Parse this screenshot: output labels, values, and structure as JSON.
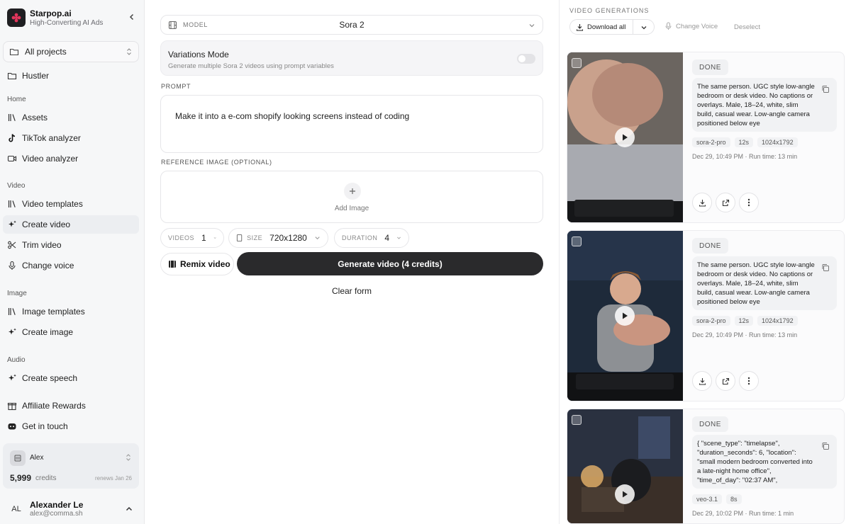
{
  "brand": {
    "name": "Starpop.ai",
    "tagline": "High-Converting AI Ads"
  },
  "projects": {
    "label": "All projects"
  },
  "sidebar": {
    "top_item": "Hustler",
    "sections": {
      "home": "Home",
      "video": "Video",
      "image": "Image",
      "audio": "Audio"
    },
    "items": {
      "assets": "Assets",
      "tiktok": "TikTok analyzer",
      "video_analyzer": "Video analyzer",
      "video_templates": "Video templates",
      "create_video": "Create video",
      "trim_video": "Trim video",
      "change_voice": "Change voice",
      "image_templates": "Image templates",
      "create_image": "Create image",
      "create_speech": "Create speech",
      "affiliate": "Affiliate Rewards",
      "get_in_touch": "Get in touch"
    }
  },
  "account": {
    "workspace": "Alex",
    "credits": "5,999",
    "credits_label": "credits",
    "renews": "renews Jan 26"
  },
  "user": {
    "initials": "AL",
    "name": "Alexander Le",
    "email": "alex@comma.sh"
  },
  "form": {
    "model_label": "MODEL",
    "model_value": "Sora 2",
    "variations_title": "Variations Mode",
    "variations_desc": "Generate multiple Sora 2 videos using prompt variables",
    "prompt_label": "PROMPT",
    "prompt_text": "Make it into a e-com shopify looking screens instead of coding",
    "reference_label": "REFERENCE IMAGE (OPTIONAL)",
    "add_image": "Add Image",
    "videos_label": "VIDEOS",
    "videos_value": "1",
    "size_label": "SIZE",
    "size_value": "720x1280",
    "duration_label": "DURATION",
    "duration_value": "4",
    "remix_label": "Remix video",
    "generate_label": "Generate video (4 credits)",
    "clear_label": "Clear form"
  },
  "generations": {
    "title": "VIDEO GENERATIONS",
    "download_all": "Download all",
    "change_voice": "Change Voice",
    "deselect": "Deselect",
    "items": [
      {
        "status": "DONE",
        "description": "The same person. UGC style low-angle bedroom or desk video. No captions or overlays. Male, 18–24, white, slim build, casual wear. Low-angle camera positioned below eye",
        "model": "sora-2-pro",
        "duration": "12s",
        "resolution": "1024x1792",
        "date": "Dec 29, 10:49 PM",
        "runtime": "Run time: 13 min"
      },
      {
        "status": "DONE",
        "description": "The same person. UGC style low-angle bedroom or desk video. No captions or overlays. Male, 18–24, white, slim build, casual wear. Low-angle camera positioned below eye",
        "model": "sora-2-pro",
        "duration": "12s",
        "resolution": "1024x1792",
        "date": "Dec 29, 10:49 PM",
        "runtime": "Run time: 13 min"
      },
      {
        "status": "DONE",
        "description": "{ \"scene_type\": \"timelapse\", \"duration_seconds\": 6, \"location\": \"small modern bedroom converted into a late-night home office\", \"time_of_day\": \"02:37 AM\",",
        "model": "veo-3.1",
        "duration": "8s",
        "resolution": "",
        "date": "Dec 29, 10:02 PM",
        "runtime": "Run time: 1 min"
      }
    ]
  },
  "colors": {
    "primary_button": "#2a2a2c",
    "sidebar_bg": "#f6f7f8",
    "logo_accent": "#e3355c"
  },
  "icons": {
    "download": "download-icon",
    "external": "external-link-icon",
    "more": "more-icon",
    "copy": "copy-icon",
    "play": "play-icon"
  }
}
